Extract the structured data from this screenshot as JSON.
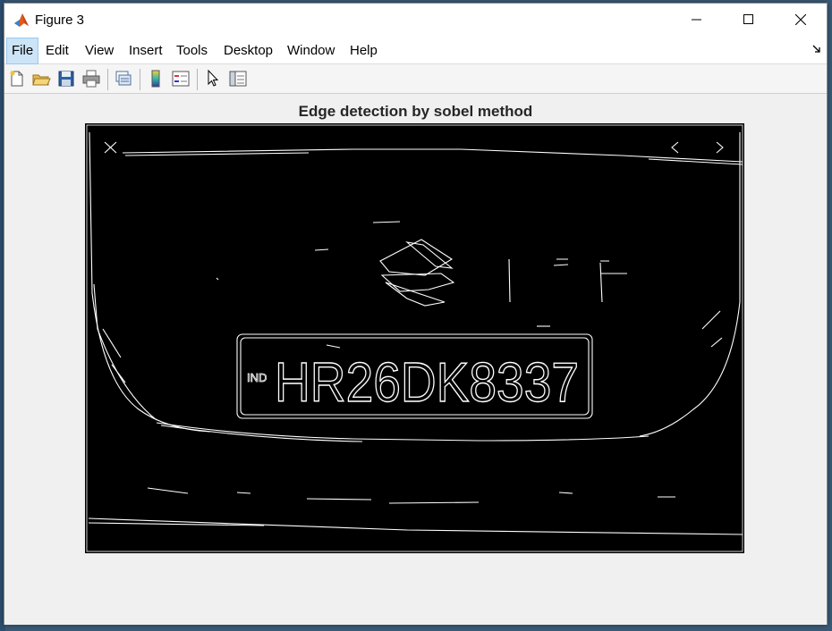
{
  "window": {
    "title": "Figure 3",
    "controls": [
      "minimize",
      "maximize",
      "close"
    ]
  },
  "menu": {
    "items": [
      {
        "label": "File",
        "active": true
      },
      {
        "label": "Edit"
      },
      {
        "label": "View"
      },
      {
        "label": "Insert"
      },
      {
        "label": "Tools"
      },
      {
        "label": "Desktop"
      },
      {
        "label": "Window"
      },
      {
        "label": "Help"
      }
    ]
  },
  "toolbar": {
    "buttons": [
      "new-figure-icon",
      "open-file-icon",
      "save-icon",
      "print-icon",
      "link-plot-icon",
      "colorbar-icon",
      "legend-icon",
      "pointer-icon",
      "property-inspector-icon"
    ]
  },
  "figure": {
    "title": "Edge detection by sobel method",
    "image": {
      "plate_text": "HR26DK8337",
      "plate_prefix": "IND",
      "background": "#000000",
      "edge_color": "#ffffff"
    }
  }
}
